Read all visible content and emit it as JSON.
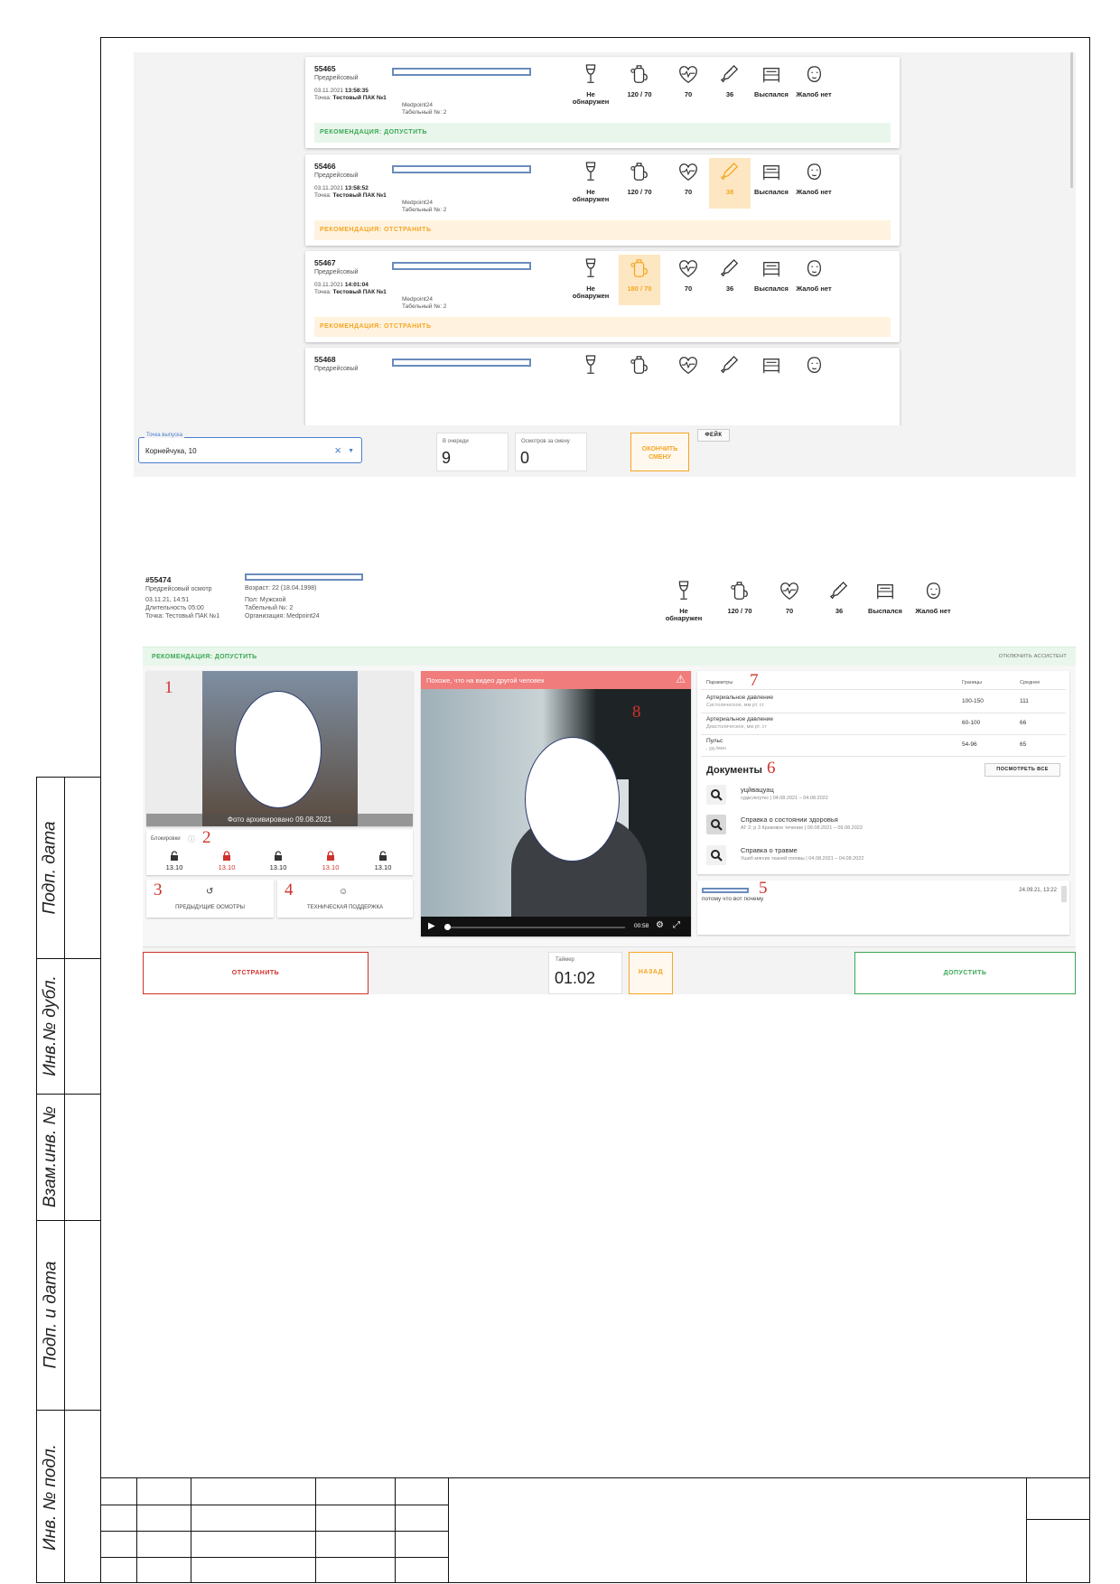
{
  "stamp": {
    "labels": [
      "Подп. дата",
      "Инв.№ дубл.",
      "Взам.инв. №",
      "Подп. и дата",
      "Инв. № подл."
    ]
  },
  "queue_screen": {
    "cards": [
      {
        "id": "55465",
        "type": "Предрейсовый",
        "date": "03.11.2021",
        "time": "13:58:35",
        "point_label": "Точка:",
        "point": "Тестовый ПАК №1",
        "org": "Medpoint24",
        "tab": "Табельный №: 2",
        "metrics": [
          {
            "icon": "wine-glass-icon",
            "value": "Не обнаружен",
            "highlight": false
          },
          {
            "icon": "blood-pressure-icon",
            "value": "120 / 70",
            "highlight": false
          },
          {
            "icon": "heart-pulse-icon",
            "value": "70",
            "highlight": false
          },
          {
            "icon": "thermometer-icon",
            "value": "36",
            "highlight": false
          },
          {
            "icon": "bed-icon",
            "value": "Выспался",
            "highlight": false
          },
          {
            "icon": "face-icon",
            "value": "Жалоб нет",
            "highlight": false
          }
        ],
        "recommendation": "РЕКОМЕНДАЦИЯ: ДОПУСТИТЬ",
        "rec_color": "green"
      },
      {
        "id": "55466",
        "type": "Предрейсовый",
        "date": "03.11.2021",
        "time": "13:58:52",
        "point_label": "Точка:",
        "point": "Тестовый ПАК №1",
        "org": "Medpoint24",
        "tab": "Табельный №: 2",
        "metrics": [
          {
            "icon": "wine-glass-icon",
            "value": "Не обнаружен",
            "highlight": false
          },
          {
            "icon": "blood-pressure-icon",
            "value": "120 / 70",
            "highlight": false
          },
          {
            "icon": "heart-pulse-icon",
            "value": "70",
            "highlight": false
          },
          {
            "icon": "thermometer-icon",
            "value": "38",
            "highlight": true
          },
          {
            "icon": "bed-icon",
            "value": "Выспался",
            "highlight": false
          },
          {
            "icon": "face-icon",
            "value": "Жалоб нет",
            "highlight": false
          }
        ],
        "recommendation": "РЕКОМЕНДАЦИЯ: ОТСТРАНИТЬ",
        "rec_color": "orange"
      },
      {
        "id": "55467",
        "type": "Предрейсовый",
        "date": "03.11.2021",
        "time": "14:01:04",
        "point_label": "Точка:",
        "point": "Тестовый ПАК №1",
        "org": "Medpoint24",
        "tab": "Табельный №: 2",
        "metrics": [
          {
            "icon": "wine-glass-icon",
            "value": "Не обнаружен",
            "highlight": false
          },
          {
            "icon": "blood-pressure-icon",
            "value": "180 / 70",
            "highlight": true
          },
          {
            "icon": "heart-pulse-icon",
            "value": "70",
            "highlight": false
          },
          {
            "icon": "thermometer-icon",
            "value": "36",
            "highlight": false
          },
          {
            "icon": "bed-icon",
            "value": "Выспался",
            "highlight": false
          },
          {
            "icon": "face-icon",
            "value": "Жалоб нет",
            "highlight": false
          }
        ],
        "recommendation": "РЕКОМЕНДАЦИЯ: ОТСТРАНИТЬ",
        "rec_color": "orange"
      },
      {
        "id": "55468",
        "type": "Предрейсовый",
        "date": "",
        "time": "",
        "point_label": "",
        "point": "",
        "org": "",
        "tab": "",
        "metrics": [
          {
            "icon": "wine-glass-icon",
            "value": "",
            "highlight": false
          },
          {
            "icon": "blood-pressure-icon",
            "value": "",
            "highlight": false
          },
          {
            "icon": "heart-pulse-icon",
            "value": "",
            "highlight": false
          },
          {
            "icon": "thermometer-icon",
            "value": "",
            "highlight": false
          },
          {
            "icon": "bed-icon",
            "value": "",
            "highlight": false
          },
          {
            "icon": "face-icon",
            "value": "",
            "highlight": false
          }
        ],
        "recommendation": "",
        "rec_color": ""
      }
    ],
    "bottom": {
      "select_label": "Точка выпуска",
      "select_value": "Корнейчука, 10",
      "queue_label": "В очереди",
      "queue_value": "9",
      "shift_label": "Осмотров за смену",
      "shift_value": "0",
      "end_shift_label": "ОКОНЧИТЬ СМЕНУ",
      "fake_label": "ФЕЙК"
    }
  },
  "exam_screen": {
    "header": {
      "id": "#55474",
      "type": "Предрейсовый осмотр",
      "datetime": "03.11.21, 14:51",
      "duration": "Длительность 05:00",
      "point": "Точка: Тестовый ПАК №1",
      "age": "Возраст: 22 (18.04.1998)",
      "sex": "Пол: Мужской",
      "tab": "Табельный №: 2",
      "org": "Организация: Medpoint24",
      "metrics": [
        {
          "icon": "wine-glass-icon",
          "value": "Не обнаружен"
        },
        {
          "icon": "blood-pressure-icon",
          "value": "120 / 70"
        },
        {
          "icon": "heart-pulse-icon",
          "value": "70"
        },
        {
          "icon": "thermometer-icon",
          "value": "36"
        },
        {
          "icon": "bed-icon",
          "value": "Выспался"
        },
        {
          "icon": "face-icon",
          "value": "Жалоб нет"
        }
      ]
    },
    "recommendation": "РЕКОМЕНДАЦИЯ: ДОПУСТИТЬ",
    "assistant_off": "ОТКЛЮЧИТЬ АССИСТЕНТ",
    "photo": {
      "number": "1",
      "caption": "Фото архивировано 09.08.2021"
    },
    "locks": {
      "number": "2",
      "label": "Блокировки",
      "items": [
        {
          "date": "13.10",
          "locked": false
        },
        {
          "date": "13.10",
          "locked": true
        },
        {
          "date": "13.10",
          "locked": false
        },
        {
          "date": "13.10",
          "locked": true
        },
        {
          "date": "13.10",
          "locked": false
        }
      ]
    },
    "prev_exams": {
      "number": "3",
      "label": "ПРЕДЫДУЩИЕ ОСМОТРЫ"
    },
    "support": {
      "number": "4",
      "label": "ТЕХНИЧЕСКАЯ ПОДДЕРЖКА"
    },
    "video": {
      "number": "8",
      "warning": "Похоже, что на видео другой человек",
      "time": "00:58"
    },
    "params": {
      "number": "7",
      "headers": [
        "Параметры",
        "Границы",
        "Среднее"
      ],
      "rows": [
        {
          "name": "Артериальное давление",
          "sub": "Систолическое, мм рт. ст",
          "range": "100-150",
          "avg": "111"
        },
        {
          "name": "Артериальное давление",
          "sub": "Диастолическое, мм рт. ст",
          "range": "60-100",
          "avg": "66"
        },
        {
          "name": "Пульс",
          "sub": ", уд./мин",
          "range": "54-96",
          "avg": "65"
        }
      ]
    },
    "documents": {
      "number": "6",
      "title": "Документы",
      "view_all": "ПОСМОТРЕТЬ ВСЕ",
      "items": [
        {
          "title": "уцйвацуац",
          "sub": "гудкслкгуткс | 04.08.2021 – 04.08.2022"
        },
        {
          "title": "Справка о состоянии здоровья",
          "sub": "АГ 2; р 3 Кризовое течение | 09.08.2021 – 09.08.2022"
        },
        {
          "title": "Справка о травме",
          "sub": "Ушиб мягких тканей головы | 04.08.2021 – 04.08.2022"
        }
      ]
    },
    "comment": {
      "number": "5",
      "text": "потому что вот почему",
      "date": "24.09.21, 13:22"
    },
    "bottom": {
      "reject_label": "ОТСТРАНИТЬ",
      "timer_label": "Таймер",
      "timer_value": "01:02",
      "back_label": "НАЗАД",
      "approve_label": "ДОПУСТИТЬ"
    }
  },
  "colors": {
    "accent": "#4a7fd1",
    "ok": "#3aa853",
    "warn": "#f5a623",
    "danger": "#d0312d"
  }
}
